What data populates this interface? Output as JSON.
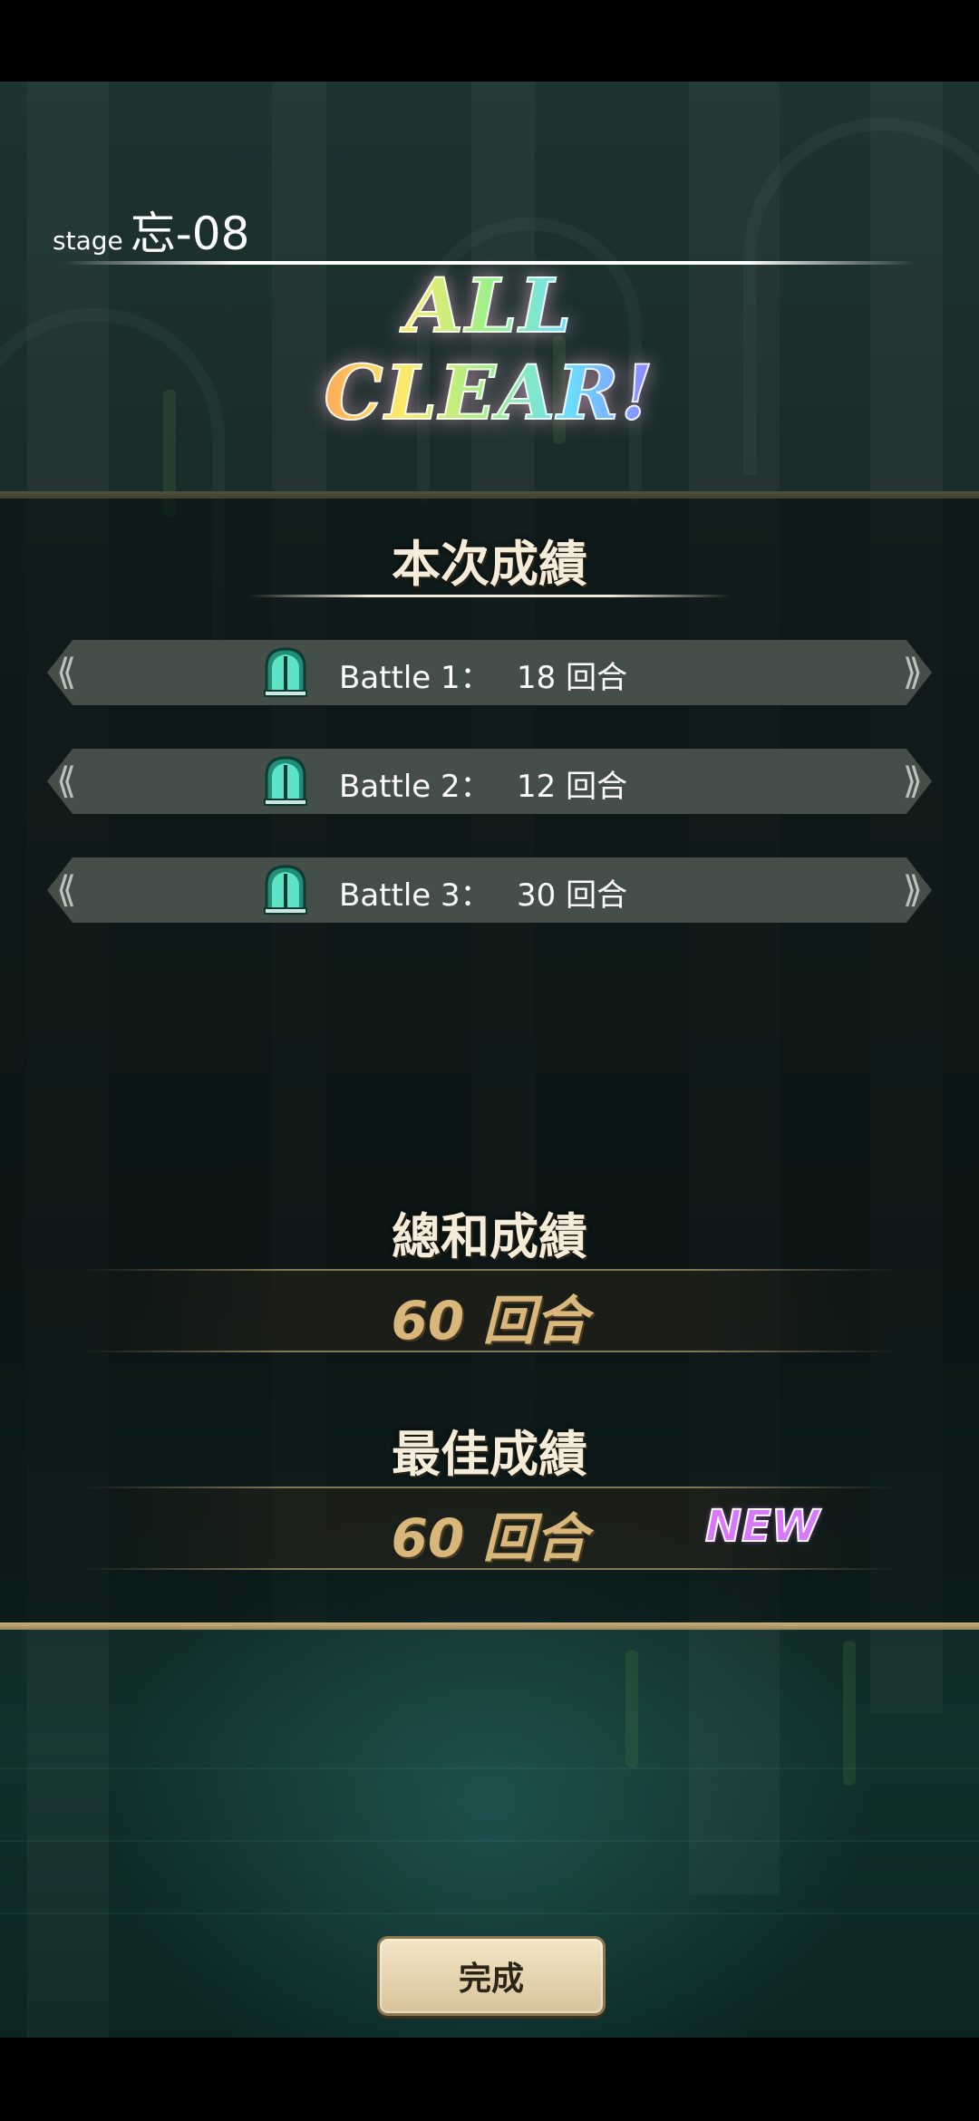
{
  "header": {
    "stage_prefix": "stage",
    "stage_code": "忘-08",
    "clear_title": "ALL CLEAR!"
  },
  "current_score": {
    "title": "本次成績",
    "battles": [
      {
        "name": "Battle 1：",
        "value": "18 回合"
      },
      {
        "name": "Battle 2：",
        "value": "12 回合"
      },
      {
        "name": "Battle 3：",
        "value": "30 回合"
      }
    ]
  },
  "total_score": {
    "title": "總和成績",
    "value": "60 回合"
  },
  "best_score": {
    "title": "最佳成績",
    "value": "60 回合",
    "badge": "NEW"
  },
  "footer": {
    "done_label": "完成"
  },
  "colors": {
    "gold_line": "#c7b283",
    "score_gold": "#d9b77a",
    "new_badge": "#d977ff",
    "battle_icon": "#2fc9a8"
  },
  "icons": {
    "battle": "gate-icon",
    "row_left": "double-chevron-left-icon",
    "row_right": "double-chevron-right-icon"
  }
}
